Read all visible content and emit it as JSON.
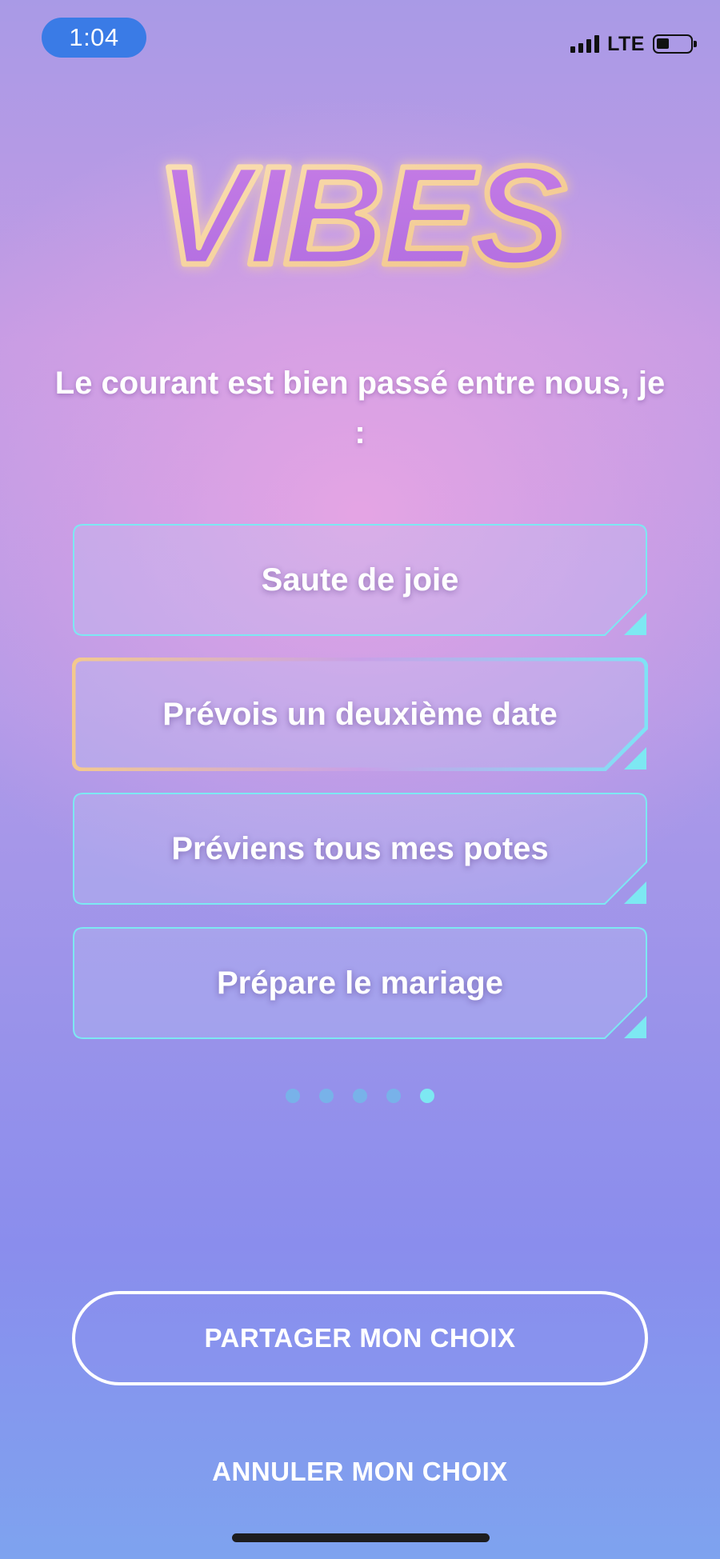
{
  "status_bar": {
    "time": "1:04",
    "network": "LTE",
    "signal_bars": 4,
    "battery_level": 0.35
  },
  "logo": {
    "text": "VIBES"
  },
  "question": "Le courant est bien passé entre nous, je :",
  "options": [
    {
      "label": "Saute de joie",
      "selected": false
    },
    {
      "label": "Prévois un deuxième date",
      "selected": true
    },
    {
      "label": "Préviens tous mes potes",
      "selected": false
    },
    {
      "label": "Prépare le mariage",
      "selected": false
    }
  ],
  "pagination": {
    "total": 5,
    "current": 5
  },
  "actions": {
    "share_label": "PARTAGER MON CHOIX",
    "cancel_label": "ANNULER MON CHOIX"
  },
  "colors": {
    "accent_cyan": "#7de8f2",
    "selected_gradient_start": "#f3c98e",
    "selected_gradient_end": "#7fe2f5",
    "status_pill": "#3a7be6"
  }
}
